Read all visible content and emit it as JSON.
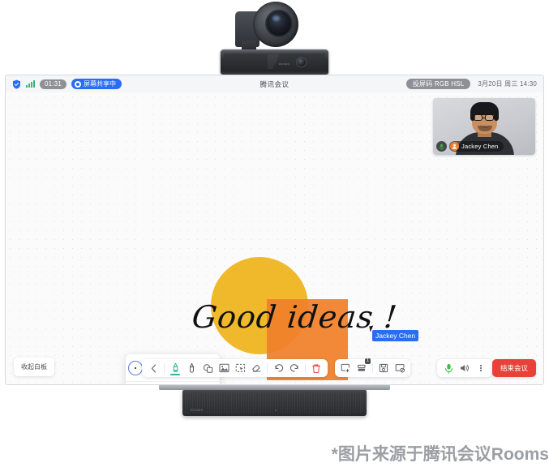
{
  "device": {
    "camera_name": "ptz-camera",
    "soundbar_name": "soundbar",
    "camera_brand": "ROOMS"
  },
  "statusbar": {
    "security_icon": "shield-icon",
    "signal_icon": "signal-bars-icon",
    "timer": "01:31",
    "share_badge": "屏幕共享中",
    "title": "腾讯会议",
    "cast_badge": "投屏码 RGB HSL",
    "datetime": "3月20日 周三 14:30"
  },
  "video_tile": {
    "participant_name": "Jackey Chen",
    "mic_icon": "microphone-icon",
    "avatar_icon": "user-avatar-icon"
  },
  "whiteboard": {
    "handwriting": "Good ideas !",
    "circle_color": "#f0b92c",
    "square_color": "#f0802a",
    "cursor_label": "Jackey Chen",
    "cursor_color": "#2b6cf6"
  },
  "palette": {
    "sizes": [
      {
        "name": "pen-size-1",
        "px": 2,
        "selected": true
      },
      {
        "name": "pen-size-2",
        "px": 3,
        "selected": false
      },
      {
        "name": "pen-size-3",
        "px": 4,
        "selected": false
      },
      {
        "name": "pen-size-4",
        "px": 5.5,
        "selected": false
      },
      {
        "name": "pen-size-5",
        "px": 8,
        "selected": false
      }
    ],
    "colors": [
      {
        "name": "color-black",
        "hex": "#16171a",
        "selected": false
      },
      {
        "name": "color-light-gray",
        "hex": "#e2e4e8",
        "selected": false
      },
      {
        "name": "color-white",
        "hex": "#ffffff",
        "selected": false
      },
      {
        "name": "color-red",
        "hex": "#d92b2b",
        "selected": false
      },
      {
        "name": "color-orange",
        "hex": "#f0802a",
        "selected": false
      },
      {
        "name": "color-gold",
        "hex": "#f0b92c",
        "selected": false
      },
      {
        "name": "color-green",
        "hex": "#43b94a",
        "selected": false
      },
      {
        "name": "color-teal",
        "hex": "#22b99a",
        "selected": true
      },
      {
        "name": "color-blue",
        "hex": "#2f86e0",
        "selected": false
      },
      {
        "name": "color-indigo",
        "hex": "#4549b5",
        "selected": false
      }
    ]
  },
  "toolbar": {
    "collapse_label": "收起白板",
    "tools": [
      {
        "name": "back-chevron-icon",
        "label": "返回",
        "selected": false
      },
      {
        "name": "highlighter-icon",
        "label": "荧光笔",
        "selected": true
      },
      {
        "name": "pen-icon",
        "label": "画笔",
        "selected": false
      },
      {
        "name": "shapes-icon",
        "label": "图形",
        "selected": false
      },
      {
        "name": "image-icon",
        "label": "图片",
        "selected": false
      },
      {
        "name": "select-icon",
        "label": "选择",
        "selected": false
      },
      {
        "name": "eraser-icon",
        "label": "橡皮擦",
        "selected": false
      },
      {
        "name": "undo-icon",
        "label": "撤销",
        "selected": false
      },
      {
        "name": "redo-icon",
        "label": "重做",
        "selected": false
      },
      {
        "name": "trash-icon",
        "label": "清空",
        "selected": false
      }
    ],
    "page_tools": [
      {
        "name": "add-page-icon",
        "label": "新建页面",
        "badge": ""
      },
      {
        "name": "page-list-icon",
        "label": "页面列表",
        "badge": "1"
      },
      {
        "name": "save-icon",
        "label": "保存",
        "badge": ""
      },
      {
        "name": "close-board-icon",
        "label": "关闭白板",
        "badge": ""
      }
    ],
    "meeting_controls": [
      {
        "name": "mic-icon",
        "label": "静音"
      },
      {
        "name": "speaker-icon",
        "label": "扬声器"
      },
      {
        "name": "more-icon",
        "label": "更多"
      }
    ],
    "end_meeting_label": "结束会议",
    "end_meeting_color": "#e8413a"
  },
  "caption": "*图片来源于腾讯会议Rooms"
}
